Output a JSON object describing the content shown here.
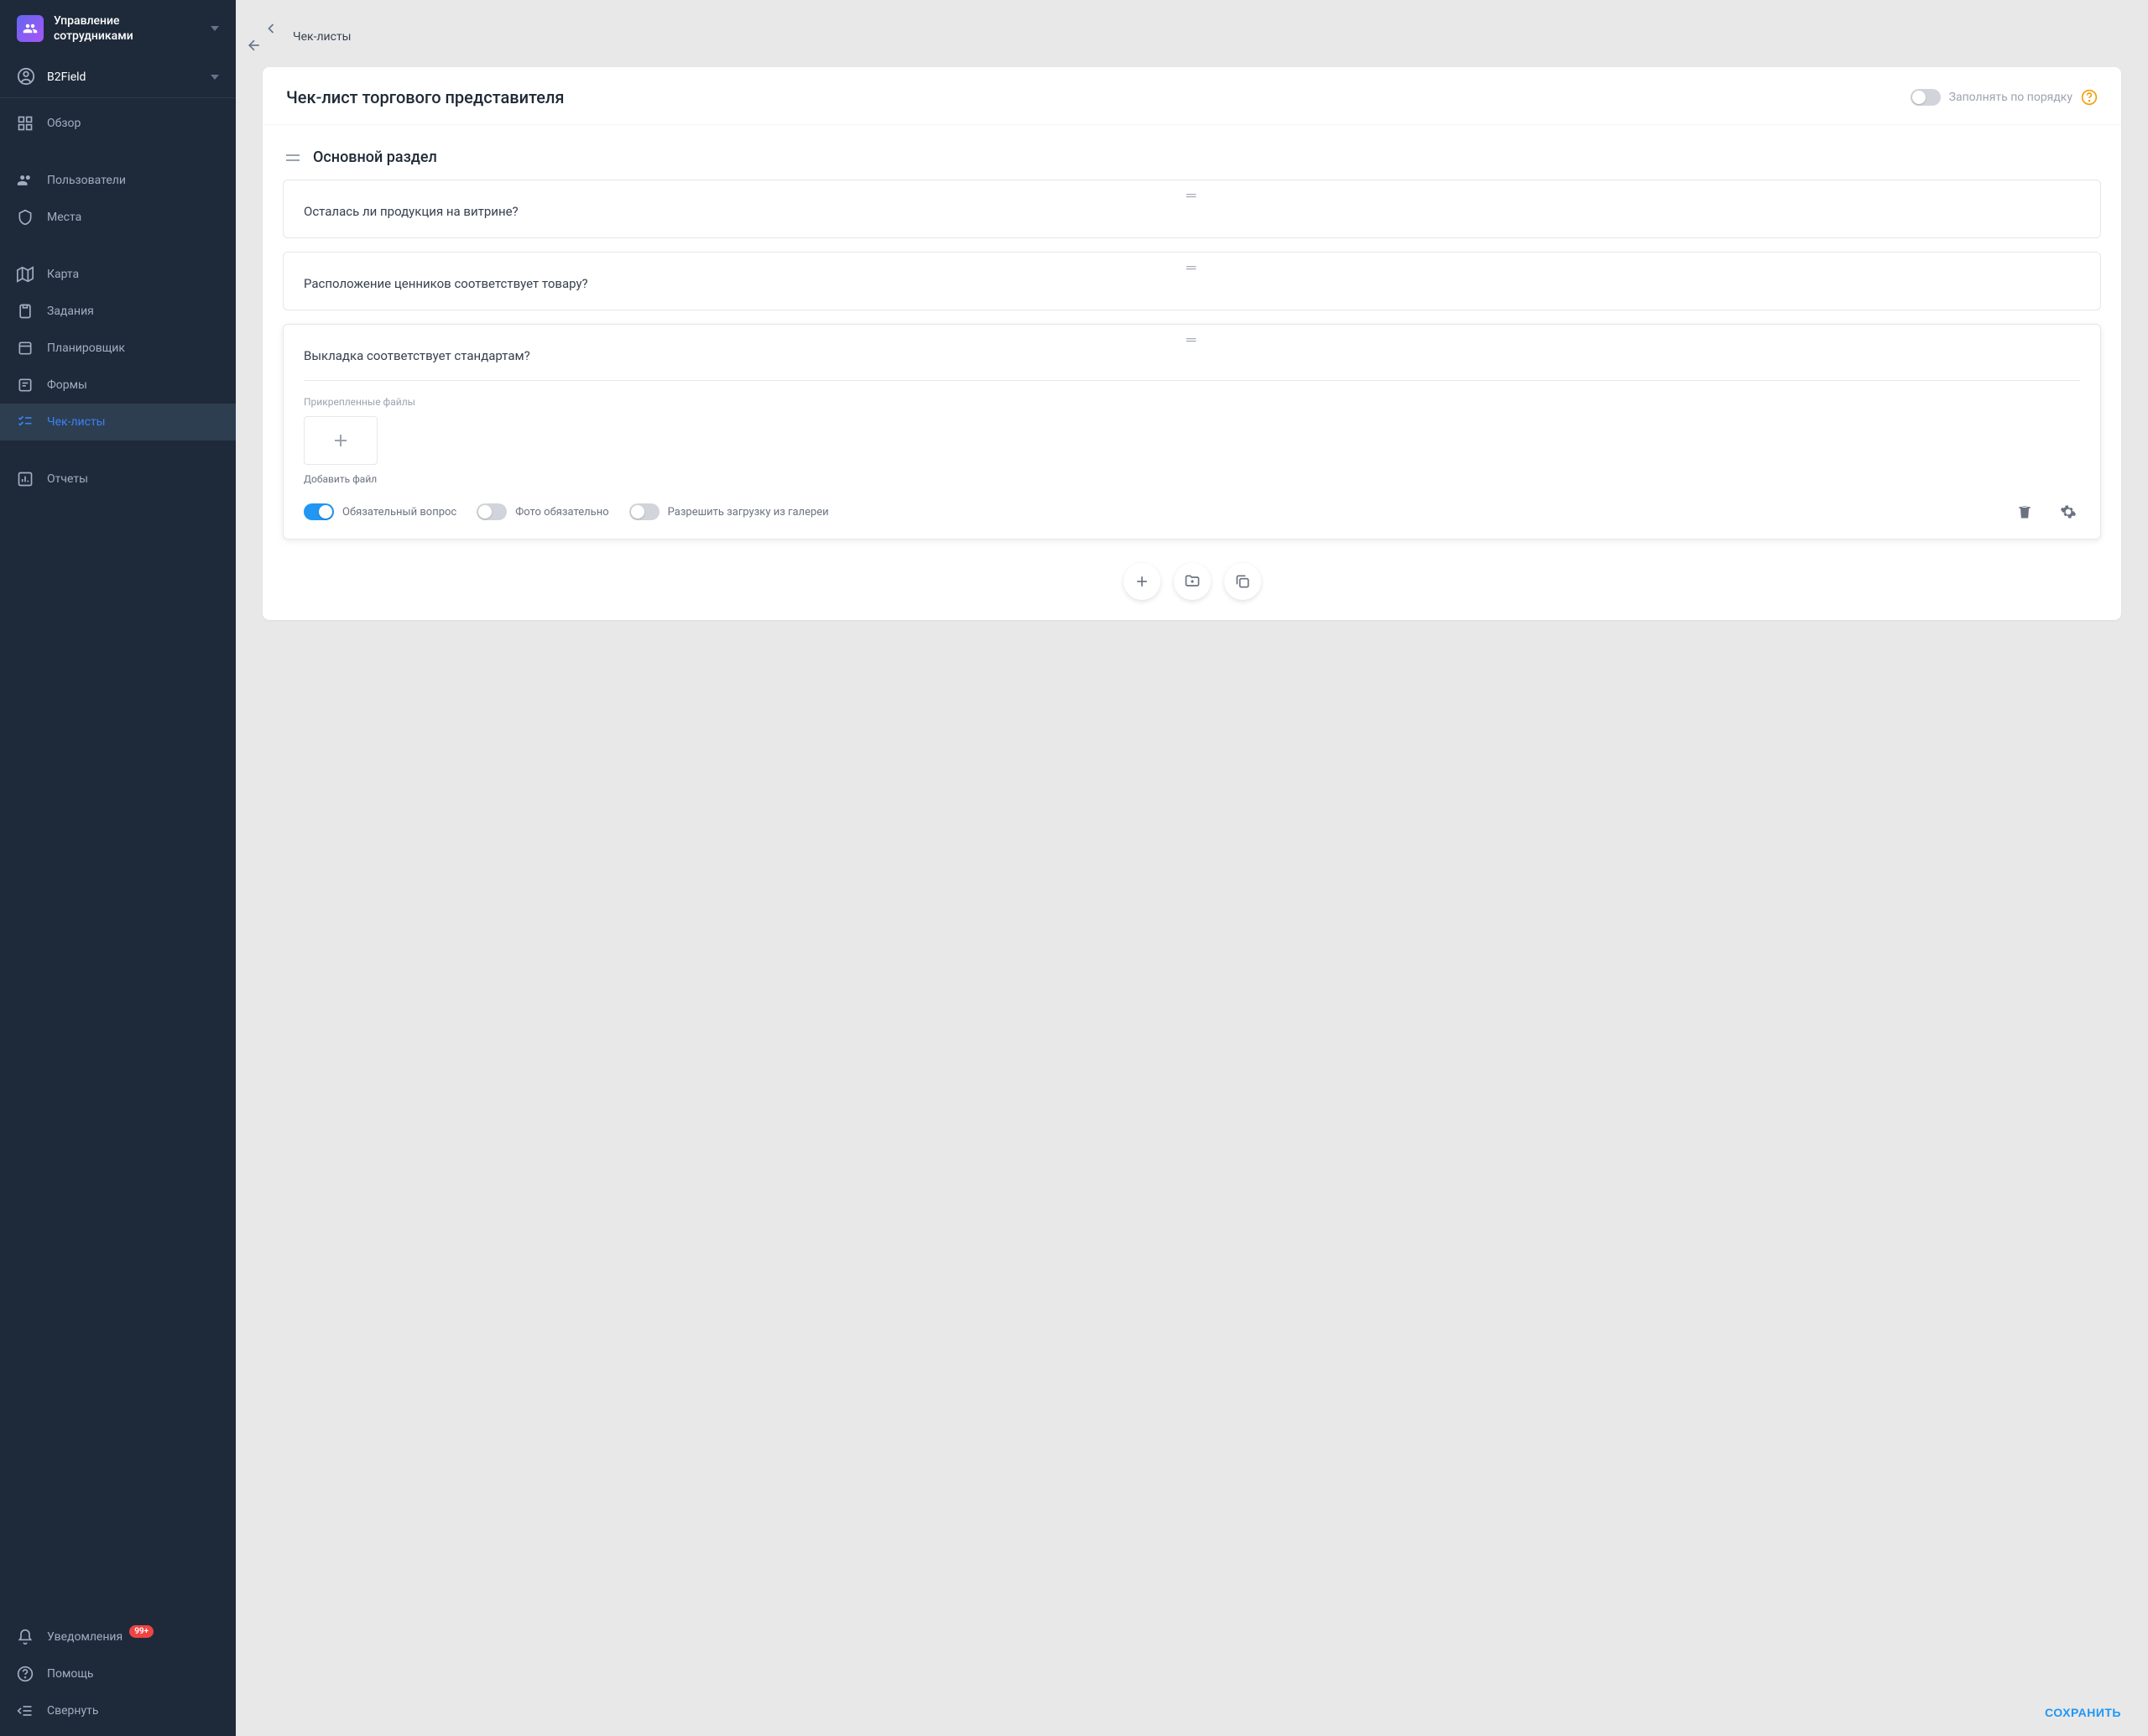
{
  "sidebar": {
    "app_title": "Управление сотрудниками",
    "user_name": "B2Field",
    "nav": {
      "overview": "Обзор",
      "users": "Пользователи",
      "places": "Места",
      "map": "Карта",
      "tasks": "Задания",
      "planner": "Планировщик",
      "forms": "Формы",
      "checklists": "Чек-листы",
      "reports": "Отчеты"
    },
    "footer": {
      "notifications": "Уведомления",
      "notifications_badge": "99+",
      "help": "Помощь",
      "collapse": "Свернуть"
    }
  },
  "header": {
    "breadcrumb": "Чек-листы"
  },
  "checklist": {
    "title": "Чек-лист торгового представителя",
    "fill_in_order_label": "Заполнять по порядку",
    "section_title": "Основной раздел",
    "questions": [
      {
        "text": "Осталась ли продукция на витрине?"
      },
      {
        "text": "Расположение ценников соответствует товару?"
      },
      {
        "text": "Выкладка соответствует стандартам?",
        "expanded": true,
        "attachments_label": "Прикрепленные файлы",
        "add_file_label": "Добавить файл",
        "required_label": "Обязательный вопрос",
        "photo_required_label": "Фото обязательно",
        "gallery_label": "Разрешить загрузку из галереи"
      }
    ]
  },
  "footer": {
    "save": "СОХРАНИТЬ"
  }
}
